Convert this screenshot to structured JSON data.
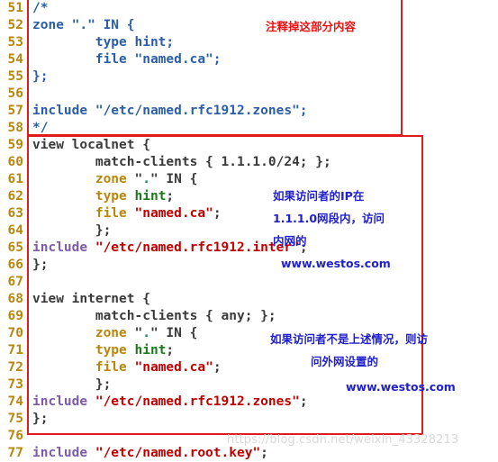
{
  "editor": {
    "language": "named.conf",
    "first_line_number": 51,
    "lines": [
      {
        "num": "51",
        "tokens": [
          {
            "t": "/*",
            "c": "t-comment"
          }
        ]
      },
      {
        "num": "52",
        "tokens": [
          {
            "t": "zone \".\" IN {",
            "c": "t-comment"
          }
        ]
      },
      {
        "num": "53",
        "tokens": [
          {
            "t": "        type hint;",
            "c": "t-comment"
          }
        ]
      },
      {
        "num": "54",
        "tokens": [
          {
            "t": "        file \"named.ca\";",
            "c": "t-comment"
          }
        ]
      },
      {
        "num": "55",
        "tokens": [
          {
            "t": "};",
            "c": "t-comment"
          }
        ]
      },
      {
        "num": "56",
        "tokens": [
          {
            "t": "",
            "c": "t-comment"
          }
        ]
      },
      {
        "num": "57",
        "tokens": [
          {
            "t": "include \"/etc/named.rfc1912.zones\";",
            "c": "t-comment"
          }
        ]
      },
      {
        "num": "58",
        "tokens": [
          {
            "t": "*/",
            "c": "t-comment"
          }
        ]
      },
      {
        "num": "59",
        "tokens": [
          {
            "t": "view localnet {",
            "c": "t-plain"
          }
        ]
      },
      {
        "num": "60",
        "tokens": [
          {
            "t": "        match-clients { 1.1.1.0/24; };",
            "c": "t-plain"
          }
        ]
      },
      {
        "num": "61",
        "tokens": [
          {
            "t": "        ",
            "c": "t-plain"
          },
          {
            "t": "zone",
            "c": "t-keyword"
          },
          {
            "t": " \"",
            "c": "t-plain"
          },
          {
            "t": ".",
            "c": "t-teal"
          },
          {
            "t": "\" IN {",
            "c": "t-plain"
          }
        ]
      },
      {
        "num": "62",
        "tokens": [
          {
            "t": "        ",
            "c": "t-plain"
          },
          {
            "t": "type",
            "c": "t-keyword"
          },
          {
            "t": " ",
            "c": "t-plain"
          },
          {
            "t": "hint",
            "c": "t-value"
          },
          {
            "t": ";",
            "c": "t-plain"
          }
        ]
      },
      {
        "num": "63",
        "tokens": [
          {
            "t": "        ",
            "c": "t-plain"
          },
          {
            "t": "file",
            "c": "t-keyword"
          },
          {
            "t": " ",
            "c": "t-plain"
          },
          {
            "t": "\"named.ca\"",
            "c": "t-string"
          },
          {
            "t": ";",
            "c": "t-plain"
          }
        ]
      },
      {
        "num": "64",
        "tokens": [
          {
            "t": "        };",
            "c": "t-plain"
          }
        ]
      },
      {
        "num": "65",
        "tokens": [
          {
            "t": "include",
            "c": "t-include"
          },
          {
            "t": " ",
            "c": "t-plain"
          },
          {
            "t": "\"/etc/named.rfc1912.inter\"",
            "c": "t-string"
          },
          {
            "t": ";",
            "c": "t-plain"
          }
        ]
      },
      {
        "num": "66",
        "tokens": [
          {
            "t": "};",
            "c": "t-plain"
          }
        ]
      },
      {
        "num": "67",
        "tokens": [
          {
            "t": "",
            "c": "t-plain"
          }
        ]
      },
      {
        "num": "68",
        "tokens": [
          {
            "t": "view internet {",
            "c": "t-plain"
          }
        ]
      },
      {
        "num": "69",
        "tokens": [
          {
            "t": "        match-clients { any; };",
            "c": "t-plain"
          }
        ]
      },
      {
        "num": "70",
        "tokens": [
          {
            "t": "        ",
            "c": "t-plain"
          },
          {
            "t": "zone",
            "c": "t-keyword"
          },
          {
            "t": " \"",
            "c": "t-plain"
          },
          {
            "t": ".",
            "c": "t-teal"
          },
          {
            "t": "\" IN {",
            "c": "t-plain"
          }
        ]
      },
      {
        "num": "71",
        "tokens": [
          {
            "t": "        ",
            "c": "t-plain"
          },
          {
            "t": "type",
            "c": "t-keyword"
          },
          {
            "t": " ",
            "c": "t-plain"
          },
          {
            "t": "hint",
            "c": "t-value"
          },
          {
            "t": ";",
            "c": "t-plain"
          }
        ]
      },
      {
        "num": "72",
        "tokens": [
          {
            "t": "        ",
            "c": "t-plain"
          },
          {
            "t": "file",
            "c": "t-keyword"
          },
          {
            "t": " ",
            "c": "t-plain"
          },
          {
            "t": "\"named.ca\"",
            "c": "t-string"
          },
          {
            "t": ";",
            "c": "t-plain"
          }
        ]
      },
      {
        "num": "73",
        "tokens": [
          {
            "t": "        };",
            "c": "t-plain"
          }
        ]
      },
      {
        "num": "74",
        "tokens": [
          {
            "t": "include",
            "c": "t-include"
          },
          {
            "t": " ",
            "c": "t-plain"
          },
          {
            "t": "\"/etc/named.rfc1912.zones\"",
            "c": "t-string"
          },
          {
            "t": ";",
            "c": "t-plain"
          }
        ]
      },
      {
        "num": "75",
        "tokens": [
          {
            "t": "};",
            "c": "t-plain"
          }
        ]
      },
      {
        "num": "76",
        "tokens": [
          {
            "t": "",
            "c": "t-plain"
          }
        ]
      },
      {
        "num": "77",
        "tokens": [
          {
            "t": "include",
            "c": "t-include"
          },
          {
            "t": " ",
            "c": "t-plain"
          },
          {
            "t": "\"/etc/named.root.key\"",
            "c": "t-string"
          },
          {
            "t": ";",
            "c": "t-plain"
          }
        ]
      }
    ]
  },
  "annotations": {
    "comment_out": "注释掉这部分内容",
    "localnet_line1": "如果访问者的IP在",
    "localnet_line2": "1.1.1.0网段内，访问",
    "localnet_line3": "内网的",
    "localnet_line4": "www.westos.com",
    "internet_line1": "如果访问者不是上述情况，则访",
    "internet_line2": "问外网设置的",
    "internet_line3": "www.westos.com"
  },
  "watermark": {
    "text": "https://blog.csdn.net/weixin_43328213"
  },
  "colors": {
    "annotation_red": "#ee1111",
    "annotation_blue": "#2020cc",
    "box_border": "#e01b1b",
    "line_number": "#b8860b",
    "comment": "#2b5ea8",
    "keyword": "#b8860b",
    "string": "#c00000",
    "value": "#1a7a1a",
    "include": "#7d5ba6",
    "plain": "#3a3a3a",
    "watermark": "#d9d9d9"
  }
}
